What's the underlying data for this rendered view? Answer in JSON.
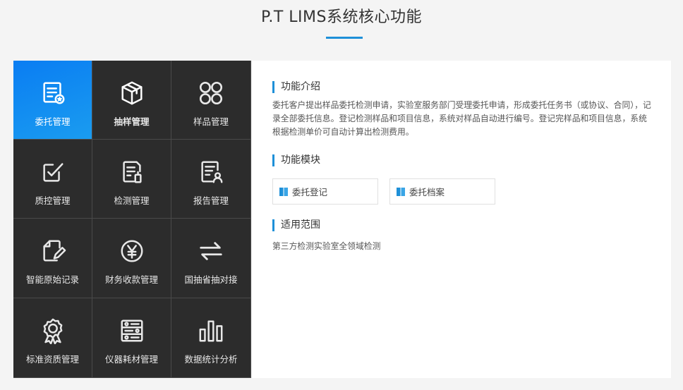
{
  "page": {
    "title": "P.T LIMS系统核心功能"
  },
  "tiles": [
    {
      "label": "委托管理",
      "icon": "entrust-doc-icon"
    },
    {
      "label": "抽样管理",
      "icon": "sampling-box-icon"
    },
    {
      "label": "样品管理",
      "icon": "samples-grid-icon"
    },
    {
      "label": "质控管理",
      "icon": "quality-check-icon"
    },
    {
      "label": "检测管理",
      "icon": "test-doc-icon"
    },
    {
      "label": "报告管理",
      "icon": "report-user-icon"
    },
    {
      "label": "智能原始记录",
      "icon": "record-edit-icon"
    },
    {
      "label": "财务收款管理",
      "icon": "yen-icon"
    },
    {
      "label": "国抽省抽对接",
      "icon": "exchange-arrows-icon"
    },
    {
      "label": "标准资质管理",
      "icon": "award-badge-icon"
    },
    {
      "label": "仪器耗材管理",
      "icon": "instrument-icon"
    },
    {
      "label": "数据统计分析",
      "icon": "bar-chart-icon"
    }
  ],
  "detail": {
    "intro_title": "功能介绍",
    "intro_text": "委托客户提出样品委托检测申请，实验室服务部门受理委托申请，形成委托任务书（或协议、合同），记录全部委托信息。登记检测样品和项目信息，系统对样品自动进行编号。登记完样品和项目信息，系统根据检测单价可自动计算出检测费用。",
    "modules_title": "功能模块",
    "modules": [
      {
        "label": "委托登记"
      },
      {
        "label": "委托档案"
      }
    ],
    "scope_title": "适用范围",
    "scope_text": "第三方检测实验室全领域检测"
  },
  "colors": {
    "accent": "#1e90d8",
    "tile_bg": "#2c2c2c",
    "active_tile": "#0a7df2"
  }
}
